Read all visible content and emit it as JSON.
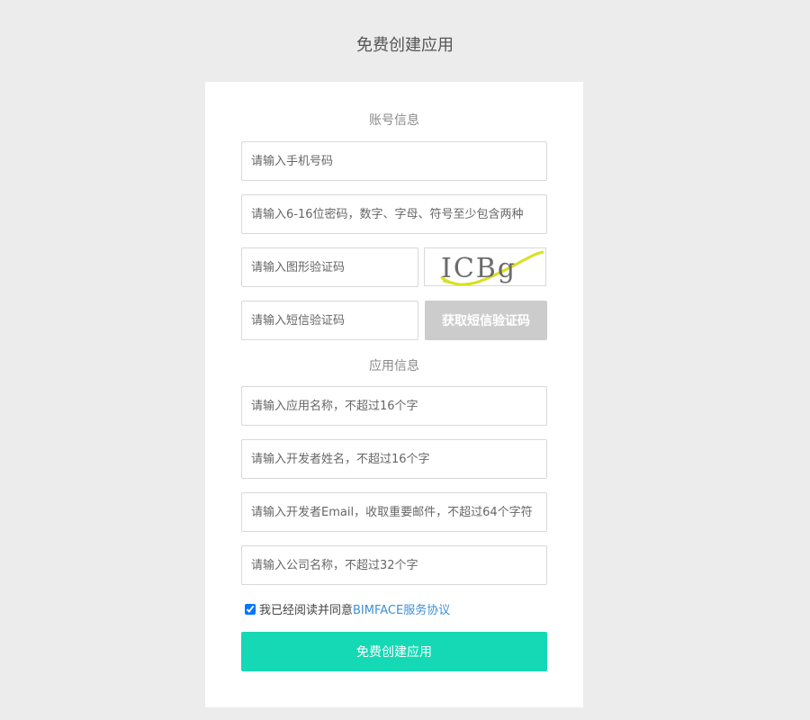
{
  "page": {
    "title": "免费创建应用"
  },
  "account_section": {
    "title": "账号信息",
    "phone_placeholder": "请输入手机号码",
    "password_placeholder": "请输入6-16位密码，数字、字母、符号至少包含两种",
    "captcha_placeholder": "请输入图形验证码",
    "captcha_text": "ICBg",
    "sms_placeholder": "请输入短信验证码",
    "sms_button_label": "获取短信验证码"
  },
  "app_section": {
    "title": "应用信息",
    "app_name_placeholder": "请输入应用名称，不超过16个字",
    "developer_name_placeholder": "请输入开发者姓名，不超过16个字",
    "developer_email_placeholder": "请输入开发者Email，收取重要邮件，不超过64个字符",
    "company_placeholder": "请输入公司名称，不超过32个字"
  },
  "agreement": {
    "checked": true,
    "text": "我已经阅读并同意",
    "link_text": "BIMFACE服务协议"
  },
  "submit_label": "免费创建应用",
  "colors": {
    "background": "#ececec",
    "submit": "#15d8b5",
    "link": "#3d8fd6",
    "disabled_button": "#cccccc"
  }
}
